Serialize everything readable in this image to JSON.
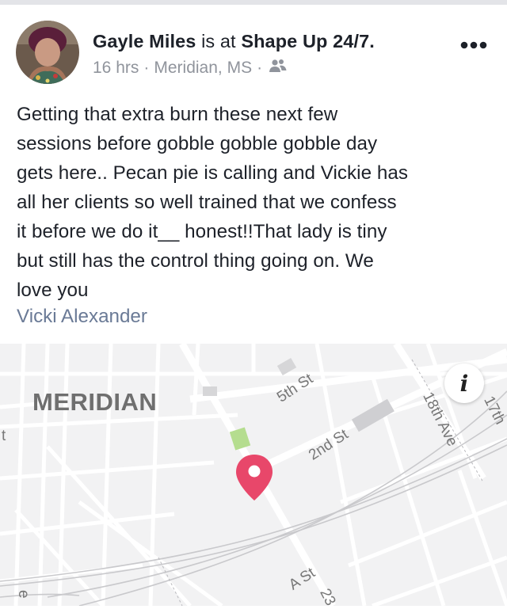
{
  "post": {
    "author": "Gayle Miles",
    "is_at": "is at",
    "place": "Shape Up 24/7.",
    "time": "16 hrs",
    "separator": "·",
    "location": "Meridian, MS",
    "audience_icon": "friends-icon",
    "more_icon": "more-dots-icon",
    "body_lines": [
      "Getting that extra burn these next few",
      "sessions before gobble gobble gobble day",
      "gets here.. Pecan pie is calling and Vickie has",
      "all her clients so well trained that we confess",
      "it before we do it__ honest!!That lady is tiny",
      "but still has the control thing going on. We",
      "love you"
    ],
    "tagged": "Vicki Alexander"
  },
  "map": {
    "city": "MERIDIAN",
    "streets": {
      "fifth": "5th St",
      "second": "2nd St",
      "eighteenth": "18th Ave",
      "seventeenth": "17th",
      "a": "A St",
      "twentythird": "23",
      "left_edge": "t",
      "bottom_left": "e"
    },
    "info_glyph": "i",
    "pin_color": "#e8476a"
  }
}
